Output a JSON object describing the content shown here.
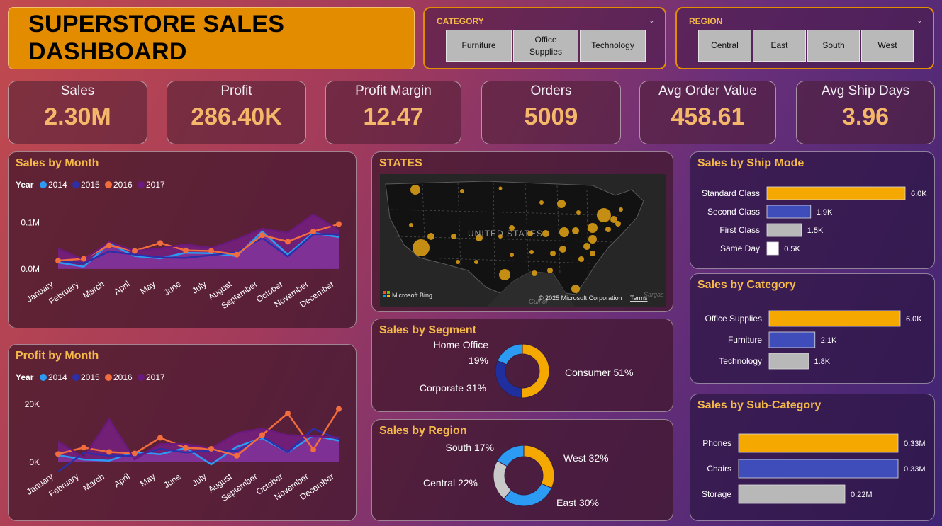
{
  "header": {
    "title": "SUPERSTORE SALES DASHBOARD"
  },
  "slicers": {
    "category": {
      "label": "CATEGORY",
      "options": [
        "Furniture",
        "Office Supplies",
        "Technology"
      ]
    },
    "region": {
      "label": "REGION",
      "options": [
        "Central",
        "East",
        "South",
        "West"
      ]
    }
  },
  "kpis": [
    {
      "label": "Sales",
      "value": "2.30M"
    },
    {
      "label": "Profit",
      "value": "286.40K"
    },
    {
      "label": "Profit Margin",
      "value": "12.47"
    },
    {
      "label": "Orders",
      "value": "5009"
    },
    {
      "label": "Avg Order Value",
      "value": "458.61"
    },
    {
      "label": "Avg Ship Days",
      "value": "3.96"
    }
  ],
  "map": {
    "title": "STATES",
    "country_label": "UNITED STATES",
    "gulf_label": "Gulf of",
    "sea_label": "Sargas",
    "bing_label": "Microsoft Bing",
    "copyright": "© 2025 Microsoft Corporation",
    "terms": "Terms"
  },
  "colors": {
    "y2014": "#2b9bf4",
    "y2015": "#2d2fa8",
    "y2016": "#f26d3d",
    "y2017": "#6a1a7e",
    "accent": "#f4a800",
    "bar2": "#3f4dbb",
    "bar3": "#b8b8b8",
    "bar4": "#ffffff"
  },
  "chart_data": [
    {
      "id": "sales_by_month",
      "type": "line",
      "title": "Sales by Month",
      "legend_title": "Year",
      "categories": [
        "January",
        "February",
        "March",
        "April",
        "May",
        "June",
        "July",
        "August",
        "September",
        "October",
        "November",
        "December"
      ],
      "y_ticks": [
        {
          "v": 0,
          "label": "0.0M"
        },
        {
          "v": 0.1,
          "label": "0.1M"
        }
      ],
      "ylim": [
        -0.02,
        0.13
      ],
      "series": [
        {
          "name": "2014",
          "values": [
            0.014,
            0.005,
            0.055,
            0.028,
            0.023,
            0.035,
            0.034,
            0.028,
            0.081,
            0.031,
            0.078,
            0.069
          ]
        },
        {
          "name": "2015",
          "values": [
            0.018,
            0.012,
            0.038,
            0.031,
            0.025,
            0.024,
            0.03,
            0.036,
            0.067,
            0.027,
            0.075,
            0.075
          ]
        },
        {
          "name": "2016",
          "values": [
            0.018,
            0.022,
            0.051,
            0.039,
            0.056,
            0.04,
            0.039,
            0.031,
            0.073,
            0.059,
            0.081,
            0.097
          ]
        },
        {
          "name": "2017",
          "values": [
            0.044,
            0.02,
            0.058,
            0.039,
            0.044,
            0.053,
            0.045,
            0.064,
            0.087,
            0.078,
            0.118,
            0.084
          ]
        }
      ]
    },
    {
      "id": "profit_by_month",
      "type": "line",
      "title": "Profit by Month",
      "legend_title": "Year",
      "categories": [
        "January",
        "February",
        "March",
        "April",
        "May",
        "June",
        "July",
        "August",
        "September",
        "October",
        "November",
        "December"
      ],
      "y_ticks": [
        {
          "v": 0,
          "label": "0K"
        },
        {
          "v": 20,
          "label": "20K"
        }
      ],
      "ylim": [
        -3,
        21
      ],
      "series": [
        {
          "name": "2014",
          "values": [
            2.4,
            0.9,
            0.5,
            3.5,
            2.7,
            4.9,
            -0.8,
            5.3,
            8.3,
            3.4,
            9.2,
            7.4
          ]
        },
        {
          "name": "2015",
          "values": [
            -3.3,
            3.2,
            2.2,
            2.1,
            4.6,
            3.3,
            4.0,
            3.8,
            8.8,
            3.4,
            11.5,
            7.9
          ]
        },
        {
          "name": "2016",
          "values": [
            2.8,
            5.0,
            3.5,
            3.0,
            8.4,
            4.9,
            4.6,
            2.2,
            9.4,
            16.9,
            4.3,
            18.4
          ]
        },
        {
          "name": "2017",
          "values": [
            7.1,
            1.6,
            14.8,
            0.9,
            6.3,
            6.2,
            4.8,
            10.0,
            11.6,
            9.3,
            9.0,
            8.5
          ]
        }
      ]
    },
    {
      "id": "sales_by_ship_mode",
      "type": "bar",
      "orientation": "horizontal",
      "title": "Sales by Ship Mode",
      "categories": [
        "Standard Class",
        "Second Class",
        "First Class",
        "Same Day"
      ],
      "values": [
        6.0,
        1.9,
        1.5,
        0.5
      ],
      "labels": [
        "6.0K",
        "1.9K",
        "1.5K",
        "0.5K"
      ],
      "xlim": [
        0,
        6.0
      ]
    },
    {
      "id": "sales_by_category",
      "type": "bar",
      "orientation": "horizontal",
      "title": "Sales by Category",
      "categories": [
        "Office Supplies",
        "Furniture",
        "Technology"
      ],
      "values": [
        6.0,
        2.1,
        1.8
      ],
      "labels": [
        "6.0K",
        "2.1K",
        "1.8K"
      ],
      "xlim": [
        0,
        6.0
      ]
    },
    {
      "id": "sales_by_subcategory",
      "type": "bar",
      "orientation": "horizontal",
      "title": "Sales by Sub-Category",
      "categories": [
        "Phones",
        "Chairs",
        "Storage"
      ],
      "values": [
        0.33,
        0.33,
        0.22
      ],
      "labels": [
        "0.33M",
        "0.33M",
        "0.22M"
      ],
      "xlim": [
        0,
        0.33
      ]
    },
    {
      "id": "sales_by_segment",
      "type": "pie",
      "style": "donut",
      "title": "Sales by Segment",
      "slices": [
        {
          "name": "Consumer",
          "value": 51,
          "label": "Consumer 51%",
          "color": "#f4a800"
        },
        {
          "name": "Corporate",
          "value": 31,
          "label": "Corporate 31%",
          "color": "#1f2f9e"
        },
        {
          "name": "Home Office",
          "value": 19,
          "label_line1": "Home Office",
          "label_line2": "19%",
          "color": "#2b9bf4"
        }
      ]
    },
    {
      "id": "sales_by_region",
      "type": "pie",
      "style": "donut",
      "title": "Sales by Region",
      "slices": [
        {
          "name": "West",
          "value": 32,
          "label": "West 32%",
          "color": "#f4a800"
        },
        {
          "name": "East",
          "value": 30,
          "label": "East 30%",
          "color": "#2b9bf4"
        },
        {
          "name": "Central",
          "value": 22,
          "label": "Central 22%",
          "color": "#c9c9c9"
        },
        {
          "name": "South",
          "value": 17,
          "label": "South 17%",
          "color": "#2b9bf4"
        }
      ]
    }
  ]
}
